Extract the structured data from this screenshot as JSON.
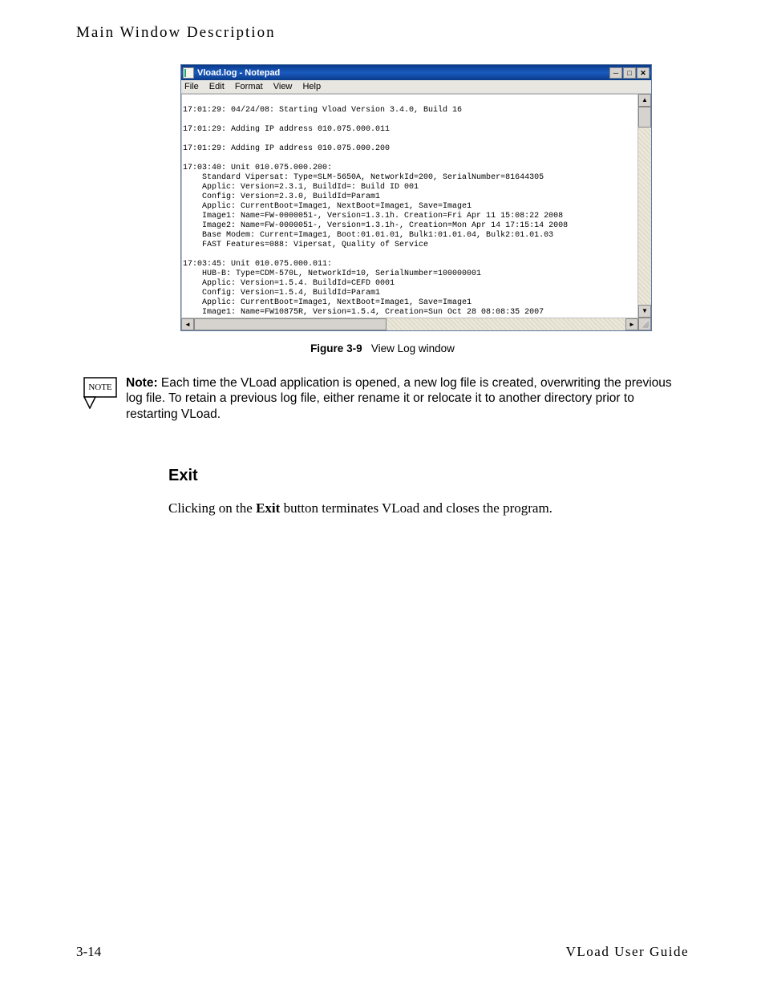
{
  "header": {
    "title": "Main Window Description"
  },
  "notepad": {
    "title": "Vload.log - Notepad",
    "menus": {
      "file": "File",
      "edit": "Edit",
      "format": "Format",
      "view": "View",
      "help": "Help"
    },
    "content": "\n17:01:29: 04/24/08: Starting Vload Version 3.4.0, Build 16\n\n17:01:29: Adding IP address 010.075.000.011\n\n17:01:29: Adding IP address 010.075.000.200\n\n17:03:40: Unit 010.075.000.200:\n    Standard Vipersat: Type=SLM-5650A, NetworkId=200, SerialNumber=81644305\n    Applic: Version=2.3.1, BuildId=: Build ID 001\n    Config: Version=2.3.0, BuildId=Param1\n    Applic: CurrentBoot=Image1, NextBoot=Image1, Save=Image1\n    Image1: Name=FW-0000051-, Version=1.3.1h. Creation=Fri Apr 11 15:08:22 2008\n    Image2: Name=FW-0000051-, Version=1.3.1h-, Creation=Mon Apr 14 17:15:14 2008\n    Base Modem: Current=Image1, Boot:01.01.01, Bulk1:01.01.04, Bulk2:01.01.03\n    FAST Features=088: Vipersat, Quality of Service\n\n17:03:45: Unit 010.075.000.011:\n    HUB-B: Type=CDM-570L, NetworkId=10, SerialNumber=100000001\n    Applic: Version=1.5.4. BuildId=CEFD 0001\n    Config: Version=1.5.4, BuildId=Param1\n    Applic: CurrentBoot=Image1, NextBoot=Image1, Save=Image1\n    Image1: Name=FW10875R, Version=1.5.4, Creation=Sun Oct 28 08:08:35 2007"
  },
  "figure": {
    "label": "Figure 3-9",
    "caption": "View Log window"
  },
  "note": {
    "badge": "NOTE",
    "label": "Note:",
    "text": "Each time the VLoad application is opened, a new log file is created, overwriting the previous log file. To retain a previous log file, either rename it or relocate it to another directory prior to restarting VLoad."
  },
  "section": {
    "heading": "Exit",
    "para_pre": "Clicking on the ",
    "para_bold": "Exit",
    "para_post": " button terminates VLoad and closes the program."
  },
  "footer": {
    "left": "3-14",
    "right": "VLoad User Guide"
  },
  "glyphs": {
    "dash": "─",
    "square": "□",
    "close": "✕",
    "up": "▲",
    "down": "▼",
    "left": "◄",
    "right": "►"
  }
}
